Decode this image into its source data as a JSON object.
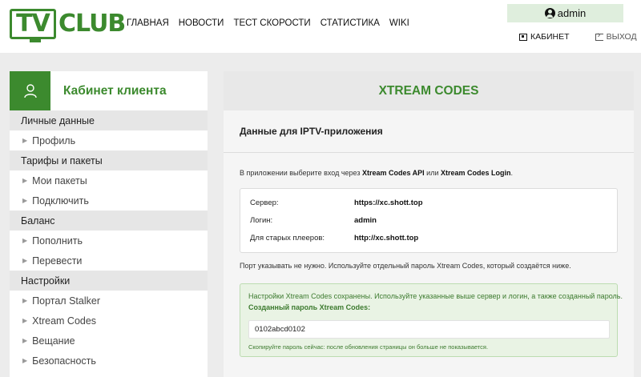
{
  "logo": {
    "tv": "TV",
    "club": "CLUB"
  },
  "nav": [
    {
      "label": "ГЛАВНАЯ"
    },
    {
      "label": "НОВОСТИ"
    },
    {
      "label": "ТЕСТ СКОРОСТИ"
    },
    {
      "label": "СТАТИСТИКА"
    },
    {
      "label": "WIKI"
    }
  ],
  "user": {
    "name": "admin",
    "icon": "user-circle-icon"
  },
  "top_links": {
    "cabinet": "КАБИНЕТ",
    "logout": "ВЫХОД"
  },
  "sidebar": {
    "title": "Кабинет клиента",
    "sections": [
      {
        "title": "Личные данные",
        "items": [
          "Профиль"
        ]
      },
      {
        "title": "Тарифы и пакеты",
        "items": [
          "Мои пакеты",
          "Подключить"
        ]
      },
      {
        "title": "Баланс",
        "items": [
          "Пополнить",
          "Перевести"
        ]
      },
      {
        "title": "Настройки",
        "items": [
          "Портал Stalker",
          "Xtream Codes",
          "Вещание",
          "Безопасность"
        ]
      }
    ]
  },
  "main": {
    "title": "XTREAM CODES",
    "subtitle": "Данные для IPTV-приложения",
    "intro_prefix": "В приложении выберите вход через ",
    "intro_api": "Xtream Codes API",
    "intro_or": " или ",
    "intro_login": "Xtream Codes Login",
    "intro_suffix": ".",
    "info": [
      {
        "label": "Сервер:",
        "value": "https://xc.shott.top"
      },
      {
        "label": "Логин:",
        "value": "admin"
      },
      {
        "label": "Для старых плееров:",
        "value": "http://xc.shott.top"
      }
    ],
    "port_note": "Порт указывать не нужно. Используйте отдельный пароль Xtream Codes, который создаётся ниже.",
    "success": {
      "message": "Настройки Xtream Codes сохранены. Используйте указанные выше сервер и логин, а также созданный пароль.",
      "password_label": "Созданный пароль Xtream Codes:",
      "password_value": "0102abcd0102",
      "note": "Скопируйте пароль сейчас: после обновления страницы он больше не показывается."
    }
  },
  "colors": {
    "accent": "#3c8a2e",
    "user_bg": "#dfeedd",
    "success_bg": "#e9f3e4"
  }
}
